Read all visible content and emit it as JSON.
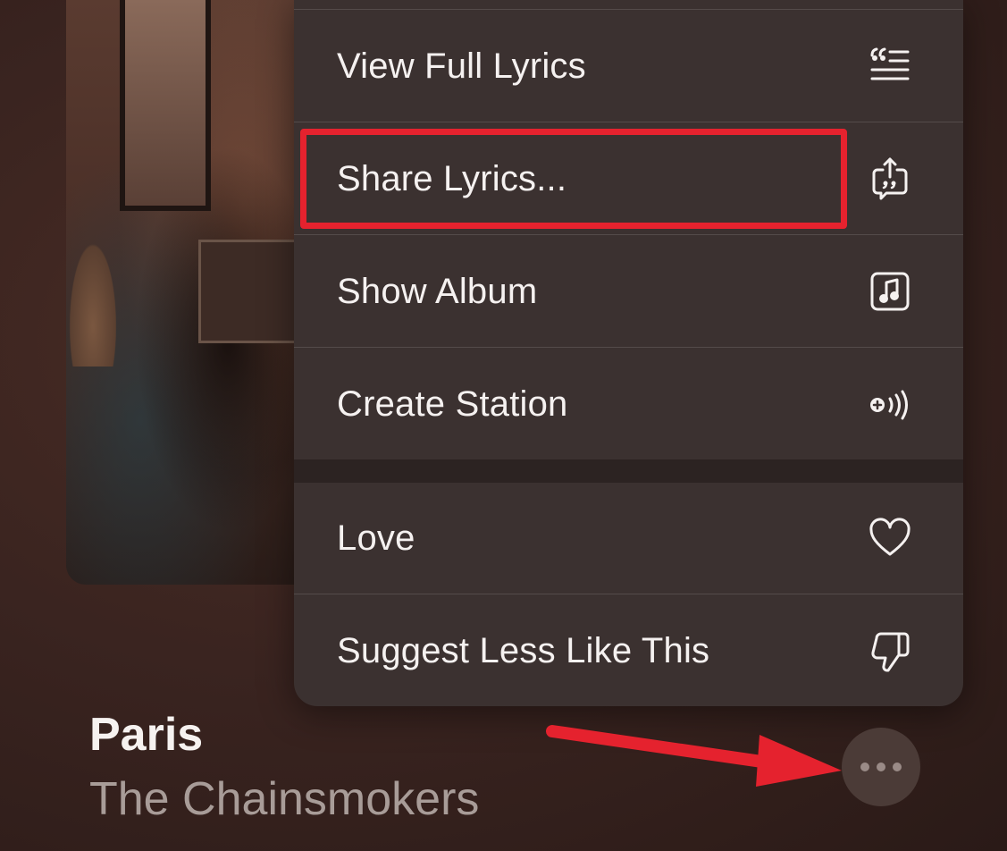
{
  "menu": {
    "items": [
      {
        "label": "View Full Lyrics",
        "icon": "lyrics-quote-icon"
      },
      {
        "label": "Share Lyrics...",
        "icon": "share-lyrics-icon"
      },
      {
        "label": "Show Album",
        "icon": "music-note-square-icon"
      },
      {
        "label": "Create Station",
        "icon": "create-station-icon"
      },
      {
        "label": "Love",
        "icon": "heart-icon"
      },
      {
        "label": "Suggest Less Like This",
        "icon": "thumbs-down-icon"
      }
    ]
  },
  "now_playing": {
    "title": "Paris",
    "artist": "The Chainsmokers"
  },
  "annotations": {
    "highlight_color": "#e5222e",
    "arrow_color": "#e5222e"
  }
}
